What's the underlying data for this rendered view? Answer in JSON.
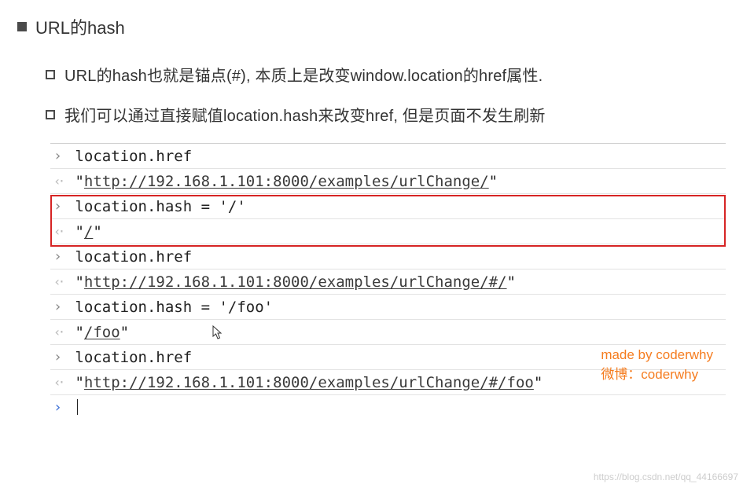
{
  "heading": "URL的hash",
  "sub_items": [
    "URL的hash也就是锚点(#), 本质上是改变window.location的href属性.",
    "我们可以通过直接赋值location.hash来改变href, 但是页面不发生刷新"
  ],
  "console": {
    "lines": [
      {
        "dir": "in",
        "text": "location.href"
      },
      {
        "dir": "out",
        "q": true,
        "url": "http://192.168.1.101:8000/examples/urlChange/"
      },
      {
        "dir": "in",
        "text": "location.hash = '/'"
      },
      {
        "dir": "out",
        "q": true,
        "url": "/"
      },
      {
        "dir": "in",
        "text": "location.href"
      },
      {
        "dir": "out",
        "q": true,
        "url": "http://192.168.1.101:8000/examples/urlChange/#/"
      },
      {
        "dir": "in",
        "text": "location.hash = '/foo'"
      },
      {
        "dir": "out",
        "q": true,
        "url": "/foo"
      },
      {
        "dir": "in",
        "text": "location.href"
      },
      {
        "dir": "out",
        "q": true,
        "url": "http://192.168.1.101:8000/examples/urlChange/#/foo"
      }
    ]
  },
  "credit": {
    "line1": "made by coderwhy",
    "line2": "微博：coderwhy"
  },
  "watermark": "https://blog.csdn.net/qq_44166697"
}
